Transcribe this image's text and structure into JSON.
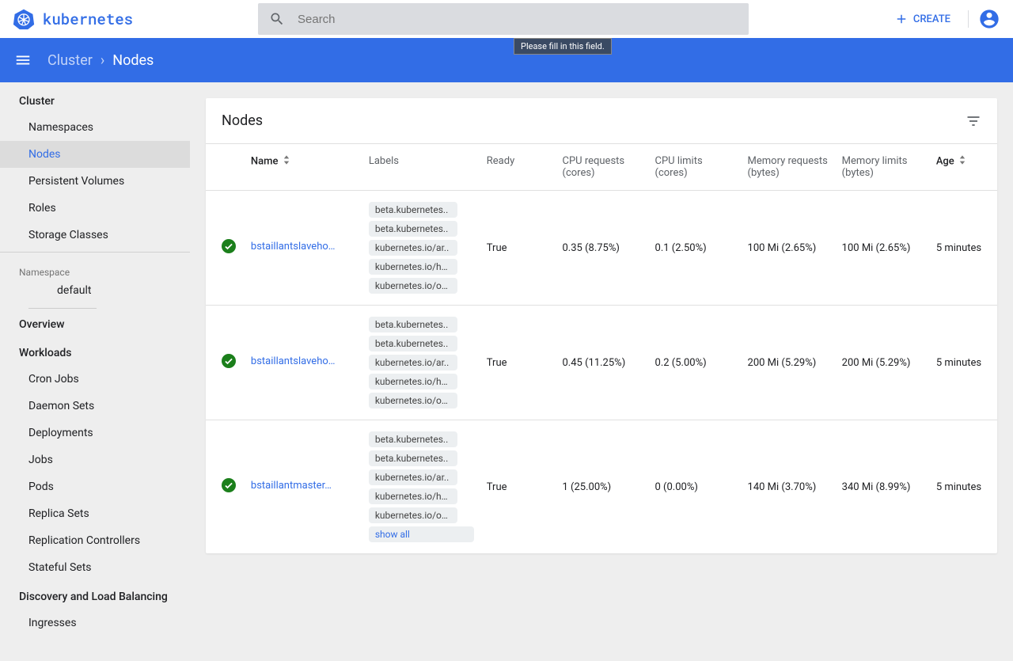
{
  "app": {
    "name": "kubernetes"
  },
  "search": {
    "placeholder": "Search",
    "tooltip": "Please fill in this field."
  },
  "actions": {
    "create": "CREATE"
  },
  "breadcrumb": {
    "root": "Cluster",
    "page": "Nodes"
  },
  "sidebar": {
    "cluster": {
      "title": "Cluster",
      "items": [
        "Namespaces",
        "Nodes",
        "Persistent Volumes",
        "Roles",
        "Storage Classes"
      ]
    },
    "namespace": {
      "label": "Namespace",
      "selected": "default"
    },
    "overview": {
      "title": "Overview"
    },
    "workloads": {
      "title": "Workloads",
      "items": [
        "Cron Jobs",
        "Daemon Sets",
        "Deployments",
        "Jobs",
        "Pods",
        "Replica Sets",
        "Replication Controllers",
        "Stateful Sets"
      ]
    },
    "discovery": {
      "title": "Discovery and Load Balancing",
      "items": [
        "Ingresses"
      ]
    }
  },
  "card": {
    "title": "Nodes",
    "show_all": "show all"
  },
  "columns": {
    "name": "Name",
    "labels": "Labels",
    "ready": "Ready",
    "cpu_req": "CPU requests (cores)",
    "cpu_lim": "CPU limits (cores)",
    "mem_req": "Memory requests (bytes)",
    "mem_lim": "Memory limits (bytes)",
    "age": "Age"
  },
  "rows": [
    {
      "name": "bstaillantslaveho…",
      "labels": [
        "beta.kubernetes..",
        "beta.kubernetes..",
        "kubernetes.io/ar..",
        "kubernetes.io/h…",
        "kubernetes.io/o…"
      ],
      "ready": "True",
      "cpu_req": "0.35 (8.75%)",
      "cpu_lim": "0.1 (2.50%)",
      "mem_req": "100 Mi (2.65%)",
      "mem_lim": "100 Mi (2.65%)",
      "age": "5 minutes",
      "show_all": false
    },
    {
      "name": "bstaillantslaveho…",
      "labels": [
        "beta.kubernetes..",
        "beta.kubernetes..",
        "kubernetes.io/ar..",
        "kubernetes.io/h…",
        "kubernetes.io/o…"
      ],
      "ready": "True",
      "cpu_req": "0.45 (11.25%)",
      "cpu_lim": "0.2 (5.00%)",
      "mem_req": "200 Mi (5.29%)",
      "mem_lim": "200 Mi (5.29%)",
      "age": "5 minutes",
      "show_all": false
    },
    {
      "name": "bstaillantmaster…",
      "labels": [
        "beta.kubernetes..",
        "beta.kubernetes..",
        "kubernetes.io/ar..",
        "kubernetes.io/h…",
        "kubernetes.io/o…"
      ],
      "ready": "True",
      "cpu_req": "1 (25.00%)",
      "cpu_lim": "0 (0.00%)",
      "mem_req": "140 Mi (3.70%)",
      "mem_lim": "340 Mi (8.99%)",
      "age": "5 minutes",
      "show_all": true
    }
  ]
}
